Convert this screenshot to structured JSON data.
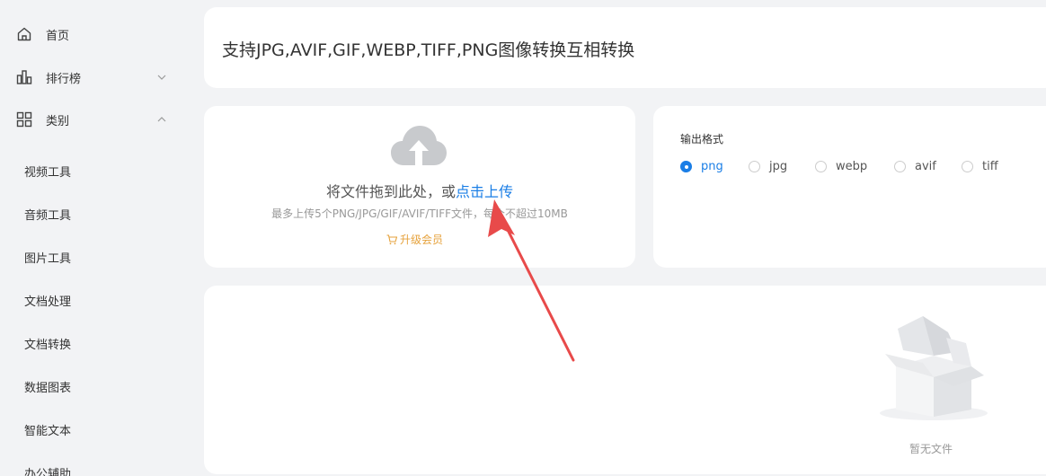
{
  "sidebar": {
    "items": [
      {
        "label": "首页",
        "icon": "home-icon"
      },
      {
        "label": "排行榜",
        "icon": "chart-bar-icon",
        "chevron": "chevron-down-icon"
      },
      {
        "label": "类别",
        "icon": "grid-icon",
        "chevron": "chevron-up-icon"
      }
    ],
    "sub_items": [
      "视频工具",
      "音频工具",
      "图片工具",
      "文档处理",
      "文档转换",
      "数据图表",
      "智能文本",
      "办公辅助"
    ]
  },
  "header": {
    "title": "支持JPG,AVIF,GIF,WEBP,TIFF,PNG图像转换互相转换"
  },
  "upload": {
    "icon": "cloud-upload-icon",
    "prompt": "将文件拖到此处，或",
    "link": "点击上传",
    "hint": "最多上传5个PNG/JPG/GIF/AVIF/TIFF文件，每个不超过10MB",
    "upgrade_icon": "cart-icon",
    "upgrade_label": "升级会员"
  },
  "format": {
    "label": "输出格式",
    "options": [
      "png",
      "jpg",
      "webp",
      "avif",
      "tiff"
    ],
    "selected": "png",
    "accent_color": "#1a7ee6"
  },
  "files": {
    "empty_icon": "empty-box-icon",
    "empty_text": "暂无文件"
  },
  "annotation": {
    "arrow_color": "#e84a4a"
  }
}
